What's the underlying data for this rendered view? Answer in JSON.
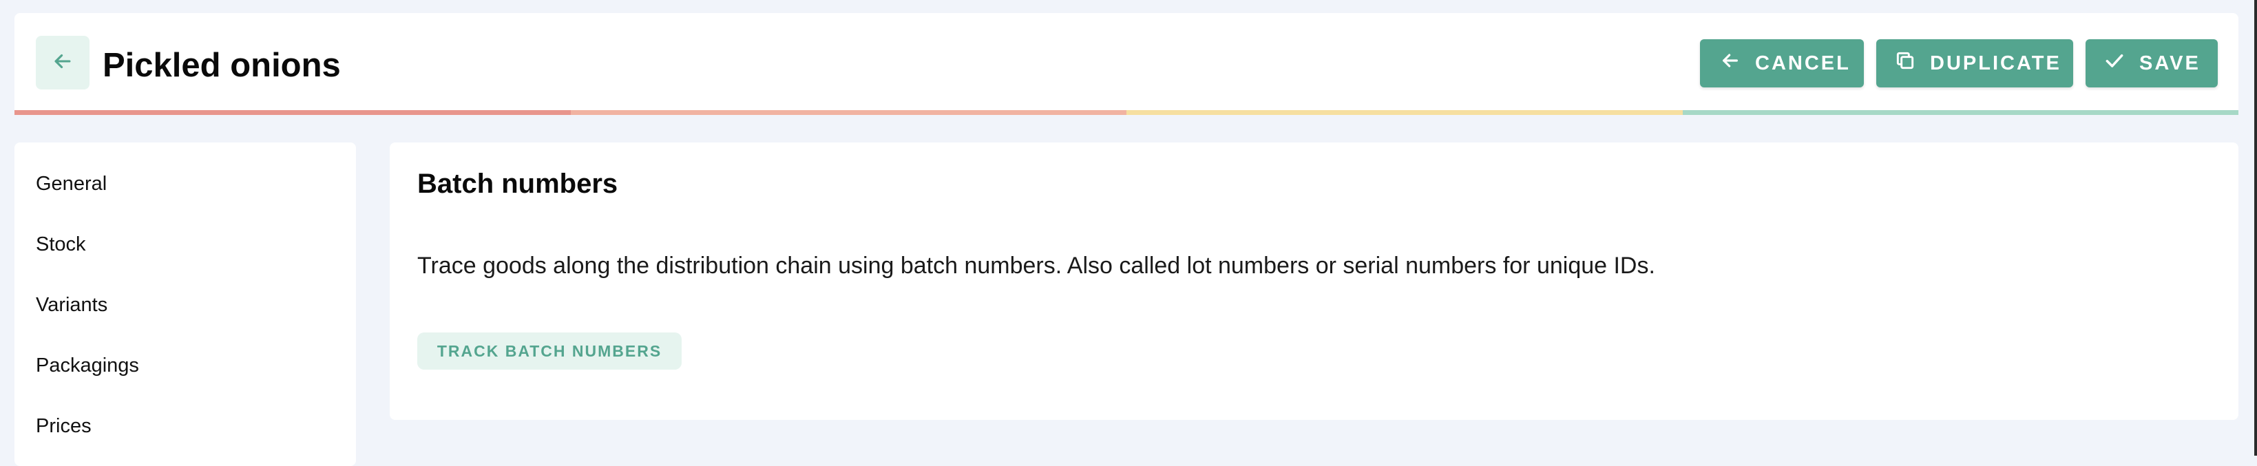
{
  "header": {
    "title": "Pickled onions",
    "actions": {
      "cancel_label": "CANCEL",
      "duplicate_label": "DUPLICATE",
      "save_label": "SAVE"
    },
    "progress_colors": [
      "#e8958c",
      "#f1b3a1",
      "#f6dfa0",
      "#a7d8c6"
    ]
  },
  "sidebar": {
    "items": [
      {
        "label": "General"
      },
      {
        "label": "Stock"
      },
      {
        "label": "Variants"
      },
      {
        "label": "Packagings"
      },
      {
        "label": "Prices"
      }
    ]
  },
  "main": {
    "section_title": "Batch numbers",
    "description": "Trace goods along the distribution chain using batch numbers. Also called lot numbers or serial numbers for unique IDs.",
    "track_button_label": "TRACK BATCH NUMBERS"
  },
  "colors": {
    "accent": "#54a58f",
    "accent_light": "#e6f4ef",
    "background": "#f1f4fa"
  },
  "icons": {
    "back": "arrow-left-icon",
    "cancel": "arrow-left-icon",
    "duplicate": "copy-icon",
    "save": "checkmark-icon"
  }
}
